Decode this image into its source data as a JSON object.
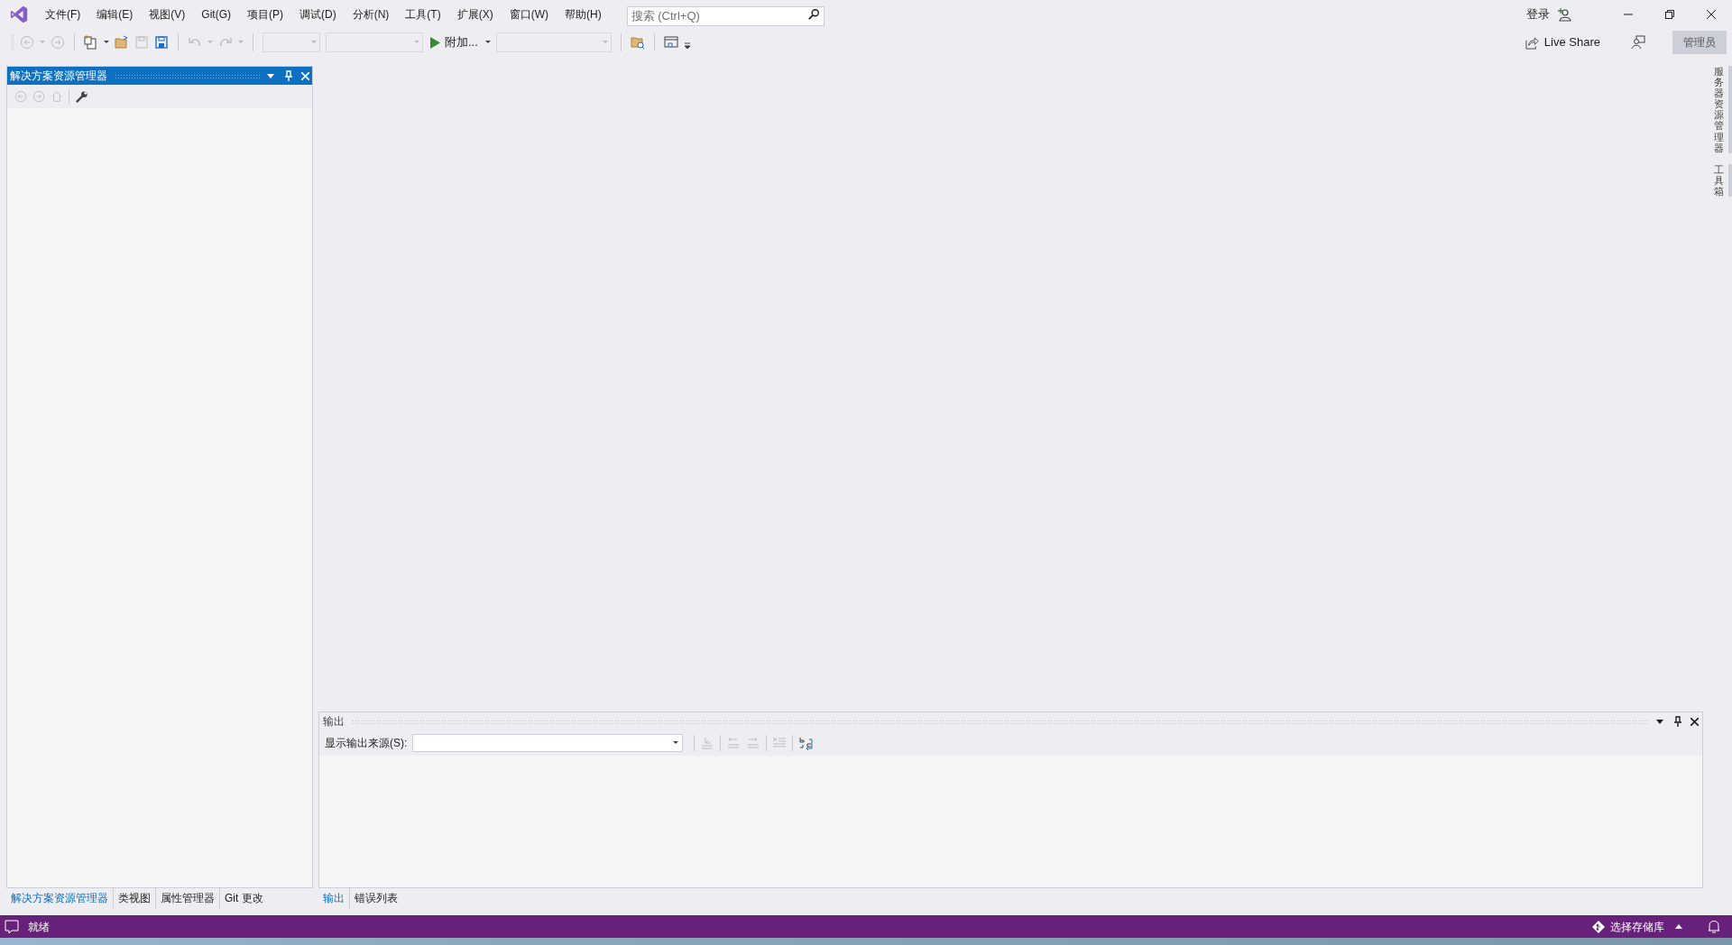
{
  "menu": [
    "文件(F)",
    "编辑(E)",
    "视图(V)",
    "Git(G)",
    "项目(P)",
    "调试(D)",
    "分析(N)",
    "工具(T)",
    "扩展(X)",
    "窗口(W)",
    "帮助(H)"
  ],
  "search": {
    "placeholder": "搜索 (Ctrl+Q)"
  },
  "sign_in": "登录",
  "attach": "附加...",
  "live_share": "Live Share",
  "admin_badge": "管理员",
  "side_tabs": [
    "服务器资源管理器",
    "工具箱"
  ],
  "solution_explorer": {
    "title": "解决方案资源管理器"
  },
  "left_tabs": [
    {
      "label": "解决方案资源管理器",
      "selected": true
    },
    {
      "label": "类视图",
      "selected": false
    },
    {
      "label": "属性管理器",
      "selected": false
    },
    {
      "label": "Git 更改",
      "selected": false
    }
  ],
  "output": {
    "title": "输出",
    "source_label": "显示输出来源(S):"
  },
  "bottom_tabs": [
    {
      "label": "输出",
      "selected": true
    },
    {
      "label": "错误列表",
      "selected": false
    }
  ],
  "status_bar": {
    "text": "就绪",
    "repo": "选择存储库"
  }
}
